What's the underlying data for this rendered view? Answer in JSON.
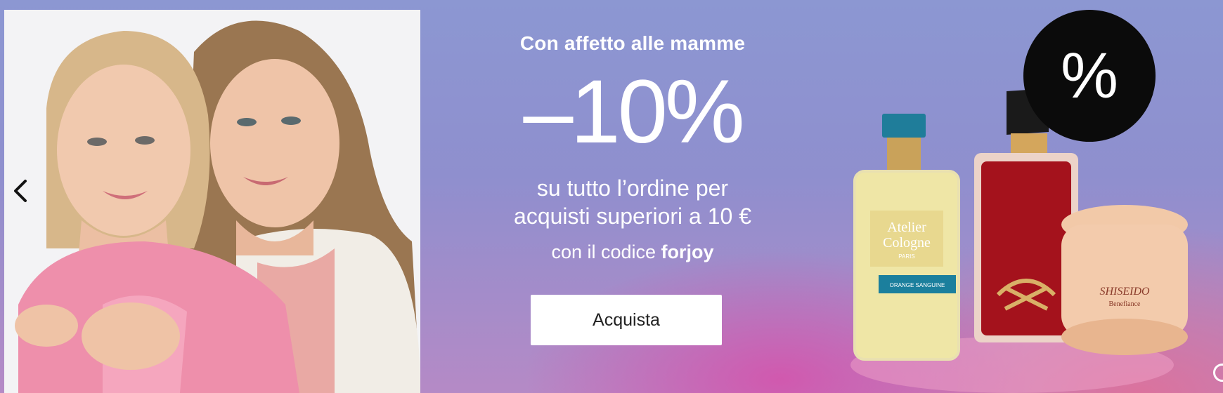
{
  "banner": {
    "kicker": "Con affetto alle mamme",
    "discount": "–10%",
    "line1": "su tutto l’ordine per",
    "line2": "acquisti superiori a 10 €",
    "code_prefix": "con il codice ",
    "code": "forjoy",
    "cta_label": "Acquista",
    "badge_symbol": "%",
    "prev_icon": "chevron-left-icon"
  },
  "products": {
    "bottle1_brand": "Atelier",
    "bottle1_brand2": "Cologne",
    "bottle1_city": "PARIS",
    "bottle1_name": "ORANGE SANGUINE",
    "cream_brand": "SHISEIDO",
    "cream_line": "Benefiance"
  }
}
